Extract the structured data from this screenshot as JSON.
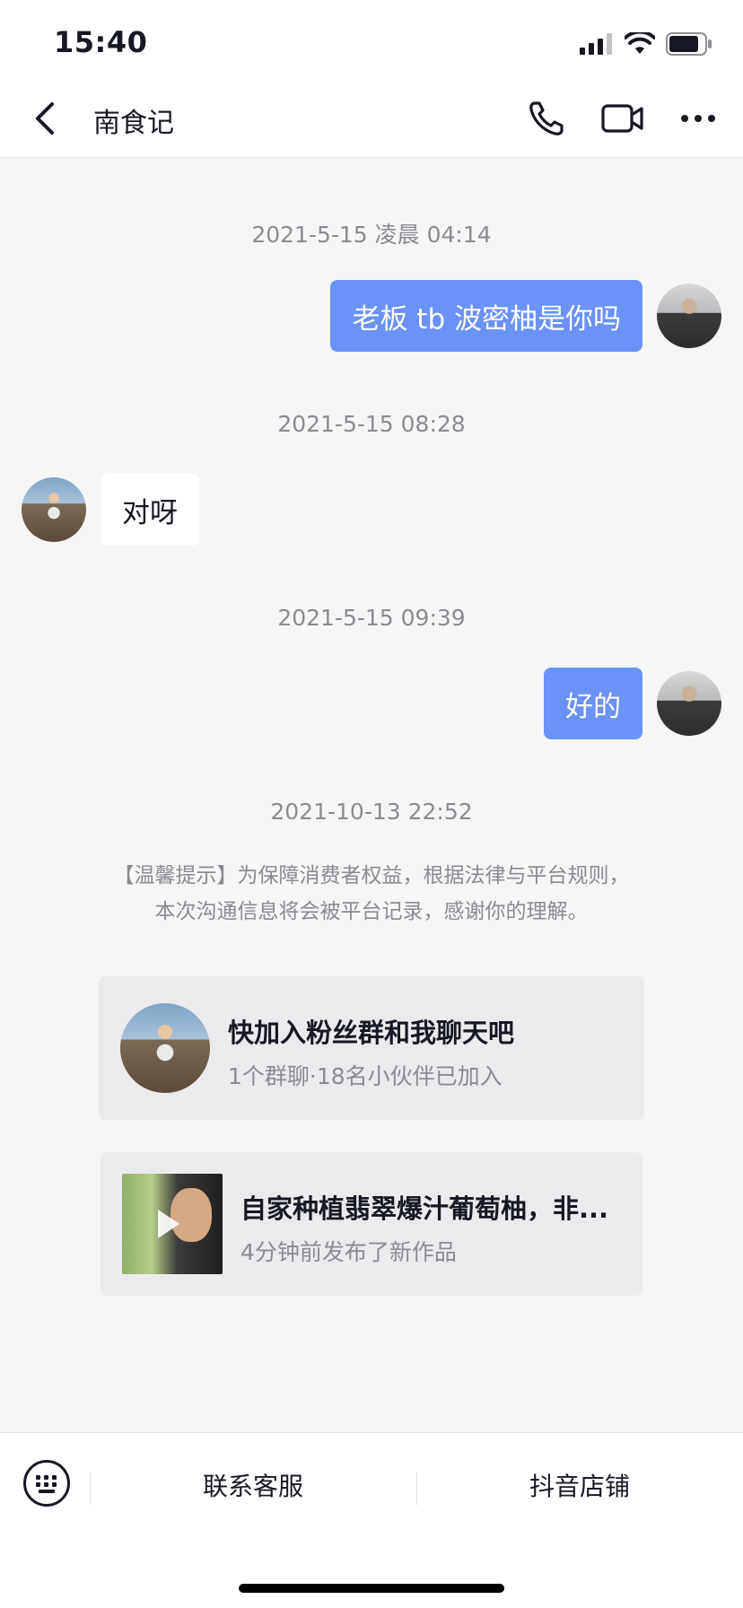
{
  "status_bar": {
    "time": "15:40"
  },
  "nav": {
    "title": "南食记"
  },
  "messages": {
    "t1": "2021-5-15 凌晨 04:14",
    "m1": "老板 tb 波密柚是你吗",
    "t2": "2021-5-15 08:28",
    "m2": "对呀",
    "t3": "2021-5-15 09:39",
    "m3": "好的",
    "t4": "2021-10-13 22:52"
  },
  "notice": {
    "line1": "【温馨提示】为保障消费者权益，根据法律与平台规则，",
    "line2": "本次沟通信息将会被平台记录，感谢你的理解。"
  },
  "group_card": {
    "title": "快加入粉丝群和我聊天吧",
    "subtitle": "1个群聊·18名小伙伴已加入"
  },
  "video_card": {
    "title": "自家种植翡翠爆汁葡萄柚，非...",
    "subtitle": "4分钟前发布了新作品"
  },
  "bottom": {
    "contact_service": "联系客服",
    "douyin_shop": "抖音店铺"
  },
  "colors": {
    "outgoing_bubble": "#6993f7",
    "background": "#f6f6f7",
    "text_secondary": "#8a8b91"
  }
}
